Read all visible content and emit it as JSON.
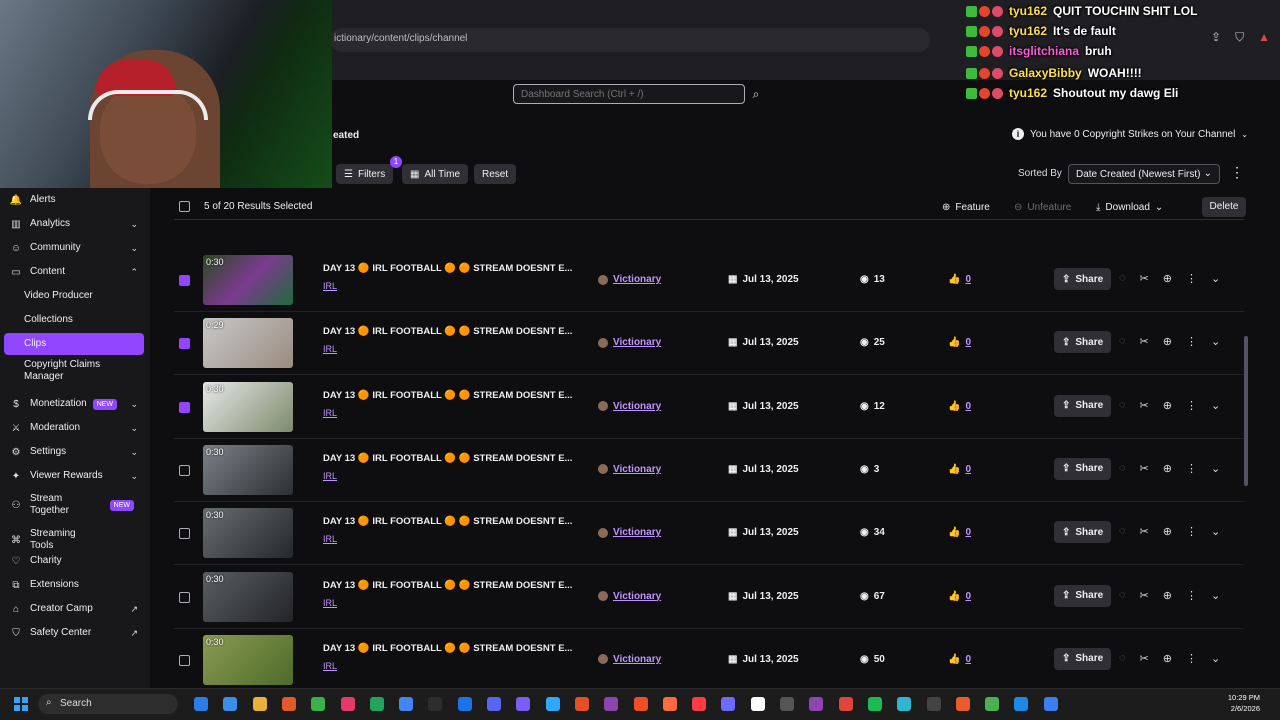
{
  "browser": {
    "url": "ictionary/content/clips/channel"
  },
  "header": {
    "search_placeholder": "Dashboard Search (Ctrl + /)",
    "page_heading_fragment": "eated",
    "copyright_notice": "You have 0 Copyright Strikes on Your Channel"
  },
  "toolbar": {
    "filters_label": "Filters",
    "filters_count": "1",
    "alltime_label": "All Time",
    "reset_label": "Reset",
    "sorted_by_label": "Sorted By",
    "sort_value": "Date Created (Newest First)"
  },
  "table_actions": {
    "selected_count": "5 of 20 Results Selected",
    "feature_label": "Feature",
    "unfeature_label": "Unfeature",
    "download_label": "Download",
    "delete_label": "Delete"
  },
  "sidebar": {
    "items": [
      {
        "label": "Alerts",
        "icon": "bell-icon",
        "has_chevron": false
      },
      {
        "label": "Analytics",
        "icon": "chart-icon",
        "has_chevron": true
      },
      {
        "label": "Community",
        "icon": "people-icon",
        "has_chevron": true
      },
      {
        "label": "Content",
        "icon": "content-icon",
        "has_chevron": true
      },
      {
        "label": "Video Producer",
        "sub": true
      },
      {
        "label": "Collections",
        "sub": true
      },
      {
        "label": "Clips",
        "sub": true,
        "active": true
      },
      {
        "label": "Copyright Claims Manager",
        "sub": true
      },
      {
        "label": "Monetization",
        "icon": "money-icon",
        "badge": "NEW",
        "has_chevron": true
      },
      {
        "label": "Moderation",
        "icon": "sword-icon",
        "has_chevron": true
      },
      {
        "label": "Settings",
        "icon": "gear-icon",
        "has_chevron": true
      },
      {
        "label": "Viewer Rewards",
        "icon": "gift-icon",
        "has_chevron": true
      },
      {
        "label": "Stream Together",
        "icon": "collab-icon",
        "badge": "NEW"
      },
      {
        "label": "Streaming Tools",
        "icon": "tools-icon"
      },
      {
        "label": "Charity",
        "icon": "heart-icon"
      },
      {
        "label": "Extensions",
        "icon": "puzzle-icon"
      },
      {
        "label": "Creator Camp",
        "icon": "tent-icon",
        "external": true
      },
      {
        "label": "Safety Center",
        "icon": "shield-icon",
        "external": true
      }
    ]
  },
  "clips": [
    {
      "duration": "0:30",
      "title": "DAY 13 🟠 IRL FOOTBALL 🟠 🟠 STREAM DOESNT E...",
      "category": "IRL",
      "creator": "Victionary",
      "date": "Jul 13, 2025",
      "views": "13",
      "likes": "0",
      "selected": true
    },
    {
      "duration": "0:29",
      "title": "DAY 13 🟠 IRL FOOTBALL 🟠 🟠 STREAM DOESNT E...",
      "category": "IRL",
      "creator": "Victionary",
      "date": "Jul 13, 2025",
      "views": "25",
      "likes": "0",
      "selected": true
    },
    {
      "duration": "0:30",
      "title": "DAY 13 🟠 IRL FOOTBALL 🟠 🟠 STREAM DOESNT E...",
      "category": "IRL",
      "creator": "Victionary",
      "date": "Jul 13, 2025",
      "views": "12",
      "likes": "0",
      "selected": true
    },
    {
      "duration": "0:30",
      "title": "DAY 13 🟠 IRL FOOTBALL 🟠 🟠 STREAM DOESNT E...",
      "category": "IRL",
      "creator": "Victionary",
      "date": "Jul 13, 2025",
      "views": "3",
      "likes": "0",
      "selected": false
    },
    {
      "duration": "0:30",
      "title": "DAY 13 🟠 IRL FOOTBALL 🟠 🟠 STREAM DOESNT E...",
      "category": "IRL",
      "creator": "Victionary",
      "date": "Jul 13, 2025",
      "views": "34",
      "likes": "0",
      "selected": false
    },
    {
      "duration": "0:30",
      "title": "DAY 13 🟠 IRL FOOTBALL 🟠 🟠 STREAM DOESNT E...",
      "category": "IRL",
      "creator": "Victionary",
      "date": "Jul 13, 2025",
      "views": "67",
      "likes": "0",
      "selected": false
    },
    {
      "duration": "0:30",
      "title": "DAY 13 🟠 IRL FOOTBALL 🟠 🟠 STREAM DOESNT E...",
      "category": "IRL",
      "creator": "Victionary",
      "date": "Jul 13, 2025",
      "views": "50",
      "likes": "0",
      "selected": false
    }
  ],
  "share_label": "Share",
  "chat": [
    {
      "user": "tyu162",
      "text": "QUIT TOUCHIN SHIT LOL",
      "color": "#ffe14d"
    },
    {
      "user": "tyu162",
      "text": "It's de fault",
      "color": "#ffe14d"
    },
    {
      "user": "itsglitchiana",
      "text": "bruh",
      "color": "#ff5bd6"
    },
    {
      "user": "GalaxyBibby",
      "text": "WOAH!!!!",
      "color": "#ffe14d"
    },
    {
      "user": "tyu162",
      "text": "Shoutout my dawg Eli",
      "color": "#ffe14d"
    }
  ],
  "taskbar": {
    "search_label": "Search",
    "time": "10:29 PM",
    "date": "2/6/2026"
  },
  "colors": {
    "accent": "#9147ff",
    "link": "#bf94ff",
    "background": "#0e0e10"
  }
}
